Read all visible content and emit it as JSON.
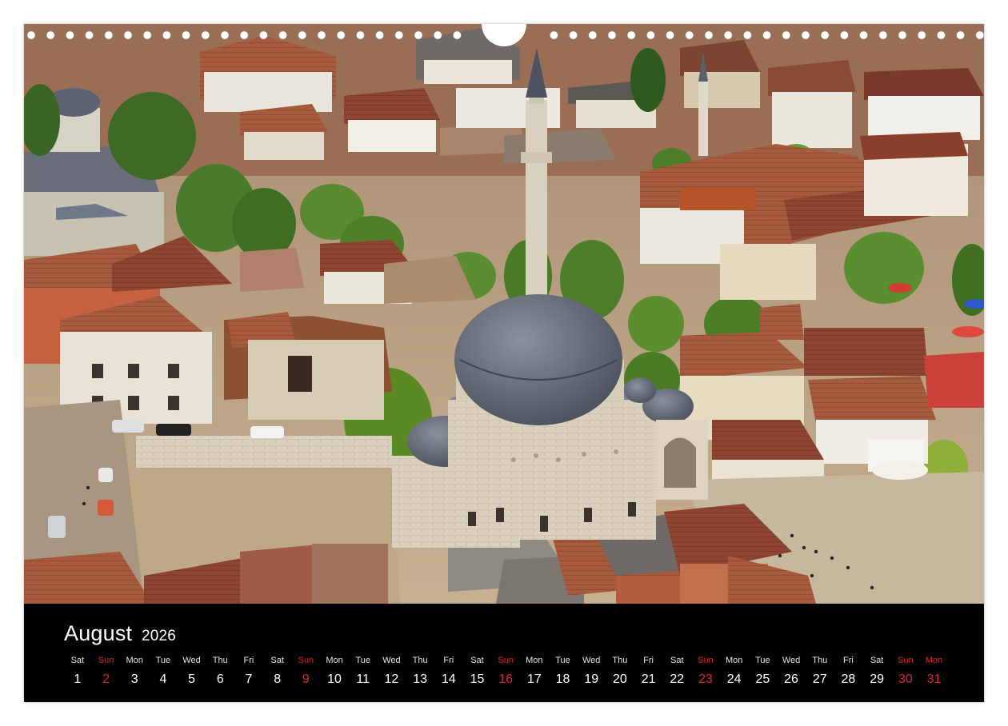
{
  "calendar": {
    "month": "August",
    "year": "2026",
    "days": [
      {
        "wd": "Sat",
        "num": "1",
        "red": false
      },
      {
        "wd": "Sun",
        "num": "2",
        "red": true
      },
      {
        "wd": "Mon",
        "num": "3",
        "red": false
      },
      {
        "wd": "Tue",
        "num": "4",
        "red": false
      },
      {
        "wd": "Wed",
        "num": "5",
        "red": false
      },
      {
        "wd": "Thu",
        "num": "6",
        "red": false
      },
      {
        "wd": "Fri",
        "num": "7",
        "red": false
      },
      {
        "wd": "Sat",
        "num": "8",
        "red": false
      },
      {
        "wd": "Sun",
        "num": "9",
        "red": true
      },
      {
        "wd": "Mon",
        "num": "10",
        "red": false
      },
      {
        "wd": "Tue",
        "num": "11",
        "red": false
      },
      {
        "wd": "Wed",
        "num": "12",
        "red": false
      },
      {
        "wd": "Thu",
        "num": "13",
        "red": false
      },
      {
        "wd": "Fri",
        "num": "14",
        "red": false
      },
      {
        "wd": "Sat",
        "num": "15",
        "red": false
      },
      {
        "wd": "Sun",
        "num": "16",
        "red": true
      },
      {
        "wd": "Mon",
        "num": "17",
        "red": false
      },
      {
        "wd": "Tue",
        "num": "18",
        "red": false
      },
      {
        "wd": "Wed",
        "num": "19",
        "red": false
      },
      {
        "wd": "Thu",
        "num": "20",
        "red": false
      },
      {
        "wd": "Fri",
        "num": "21",
        "red": false
      },
      {
        "wd": "Sat",
        "num": "22",
        "red": false
      },
      {
        "wd": "Sun",
        "num": "23",
        "red": true
      },
      {
        "wd": "Mon",
        "num": "24",
        "red": false
      },
      {
        "wd": "Tue",
        "num": "25",
        "red": false
      },
      {
        "wd": "Wed",
        "num": "26",
        "red": false
      },
      {
        "wd": "Thu",
        "num": "27",
        "red": false
      },
      {
        "wd": "Fri",
        "num": "28",
        "red": false
      },
      {
        "wd": "Sat",
        "num": "29",
        "red": false
      },
      {
        "wd": "Sun",
        "num": "30",
        "red": true
      },
      {
        "wd": "Mon",
        "num": "31",
        "red": true
      }
    ]
  },
  "photo": {
    "subject": "mosque-with-minaret-over-old-town",
    "colors": {
      "roof": "#a0523a",
      "stone": "#d8cdb8",
      "dome": "#5f6672",
      "tree": "#4f7a2a",
      "plaza": "#c2ad8c"
    }
  },
  "colors": {
    "holiday_red": "#e0262a",
    "bar_bg": "#000000",
    "text": "#ffffff"
  }
}
